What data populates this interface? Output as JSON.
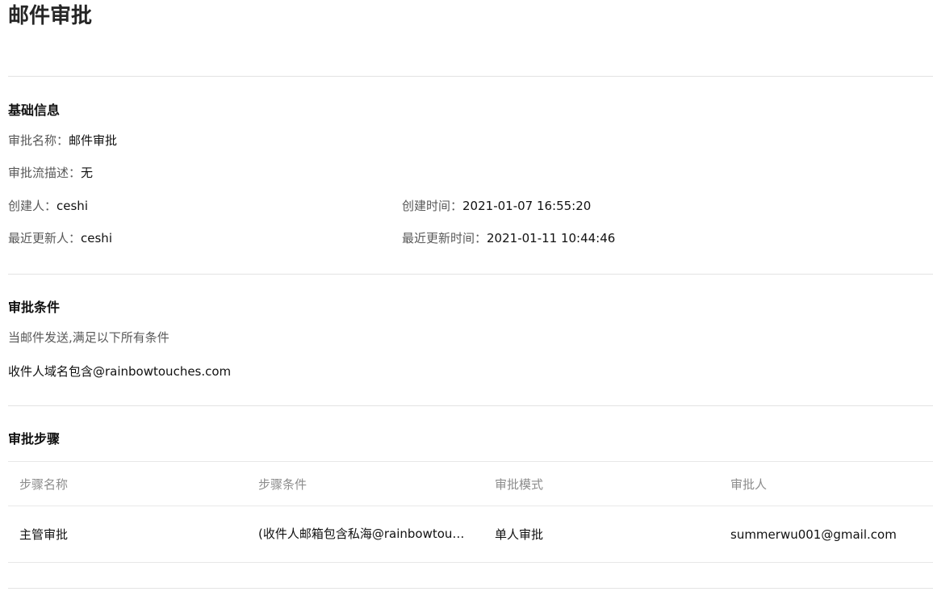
{
  "page": {
    "title": "邮件审批"
  },
  "basic_info": {
    "heading": "基础信息",
    "name_label": "审批名称：",
    "name_value": "邮件审批",
    "desc_label": "审批流描述：",
    "desc_value": "无",
    "creator_label": "创建人：",
    "creator_value": "ceshi",
    "created_label": "创建时间：",
    "created_value": "2021-01-07 16:55:20",
    "updater_label": "最近更新人：",
    "updater_value": "ceshi",
    "updated_label": "最近更新时间：",
    "updated_value": "2021-01-11 10:44:46"
  },
  "conditions": {
    "heading": "审批条件",
    "intro": "当邮件发送,满足以下所有条件",
    "rule": "收件人域名包含@rainbowtouches.com"
  },
  "steps": {
    "heading": "审批步骤",
    "columns": [
      "步骤名称",
      "步骤条件",
      "审批模式",
      "审批人"
    ],
    "rows": [
      {
        "name": "主管审批",
        "condition": "(收件人邮箱包含私海@rainbowtouches.com)",
        "mode": "单人审批",
        "approver": "summerwu001@gmail.com"
      }
    ]
  }
}
